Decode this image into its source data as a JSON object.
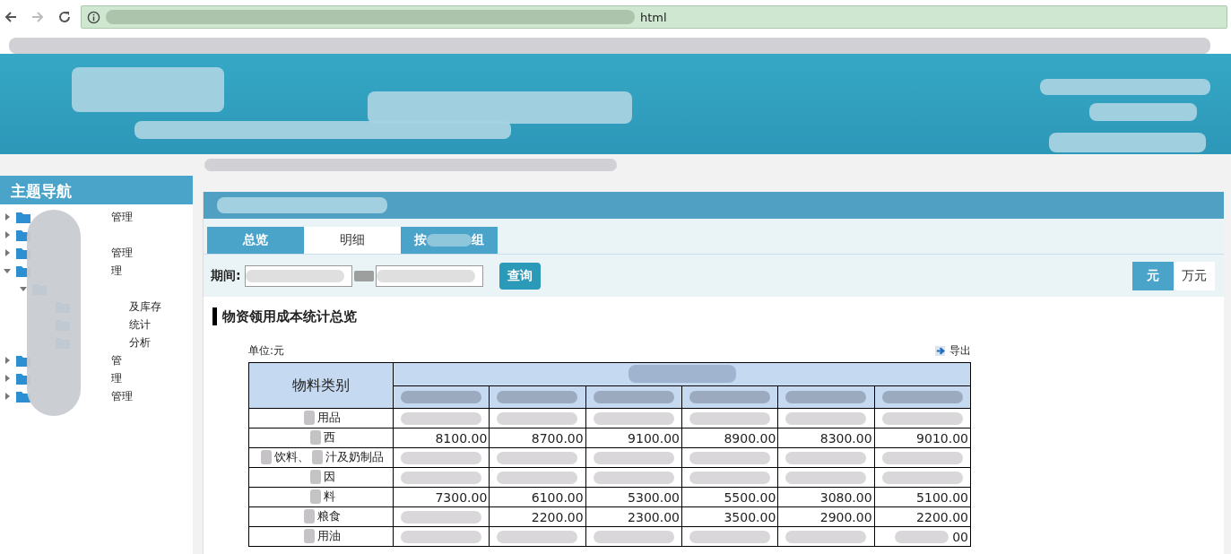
{
  "browser": {
    "address_tail": "html"
  },
  "sidebar": {
    "title": "主题导航",
    "items": [
      {
        "label": "管理",
        "expanded": false
      },
      {
        "expanded": false
      },
      {
        "label": "管理",
        "expanded": false
      },
      {
        "label": "理",
        "expanded": true,
        "children": [
          {
            "expanded": true,
            "children": [
              {
                "label": "及库存"
              },
              {
                "label": "统计"
              },
              {
                "label": "分析"
              }
            ]
          }
        ]
      },
      {
        "label": "管",
        "expanded": false
      },
      {
        "label": "理",
        "expanded": false
      },
      {
        "label": "管理",
        "expanded": false
      }
    ]
  },
  "tabs": [
    {
      "label": "总览",
      "selected": true
    },
    {
      "label": "明细",
      "selected": false
    },
    {
      "label": "按",
      "selected": true,
      "tail": "组"
    }
  ],
  "filter": {
    "label": "期间:",
    "query_button": "查询",
    "units": [
      {
        "label": "元",
        "selected": true
      },
      {
        "label": "万元",
        "selected": false
      }
    ]
  },
  "section_title": "物资领用成本统计总览",
  "unit_note": "单位:元",
  "export_link": "导出",
  "table": {
    "category_header": "物料类别",
    "rows": [
      {
        "label_parts": [
          "用品"
        ],
        "cells": [
          {
            "blurred": true
          },
          {
            "blurred": true
          },
          {
            "blurred": true
          },
          {
            "blurred": true
          },
          {
            "blurred": true
          },
          {
            "blurred": true
          }
        ]
      },
      {
        "label_parts": [
          "西"
        ],
        "cells": [
          {
            "text": "8100.00"
          },
          {
            "text": "8700.00"
          },
          {
            "text": "9100.00"
          },
          {
            "text": "8900.00"
          },
          {
            "text": "8300.00"
          },
          {
            "text": "9010.00"
          }
        ]
      },
      {
        "label_parts": [
          "饮料、",
          "汁及奶制品"
        ],
        "cells": [
          {
            "blurred": true
          },
          {
            "blurred": true
          },
          {
            "blurred": true
          },
          {
            "blurred": true
          },
          {
            "blurred": true
          },
          {
            "blurred": true
          }
        ]
      },
      {
        "label_parts": [
          "因"
        ],
        "cells": [
          {
            "blurred": true
          },
          {
            "blurred": true
          },
          {
            "blurred": true
          },
          {
            "blurred": true
          },
          {
            "blurred": true
          },
          {
            "blurred": true
          }
        ]
      },
      {
        "label_parts": [
          "料"
        ],
        "cells": [
          {
            "text": "7300.00"
          },
          {
            "text": "6100.00"
          },
          {
            "text": "5300.00"
          },
          {
            "text": "5500.00"
          },
          {
            "text": "3080.00"
          },
          {
            "text": "5100.00"
          }
        ]
      },
      {
        "label_parts": [
          "粮食"
        ],
        "cells": [
          {
            "blurred": true
          },
          {
            "text": "2200.00"
          },
          {
            "text": "2300.00"
          },
          {
            "text": "3500.00"
          },
          {
            "text": "2900.00"
          },
          {
            "text": "2200.00"
          }
        ]
      },
      {
        "label_parts": [
          "用油"
        ],
        "cells": [
          {
            "blurred": true
          },
          {
            "blurred": true
          },
          {
            "blurred": true
          },
          {
            "blurred": true
          },
          {
            "blurred": true
          },
          {
            "text": "00",
            "blurred": true
          }
        ]
      }
    ]
  }
}
